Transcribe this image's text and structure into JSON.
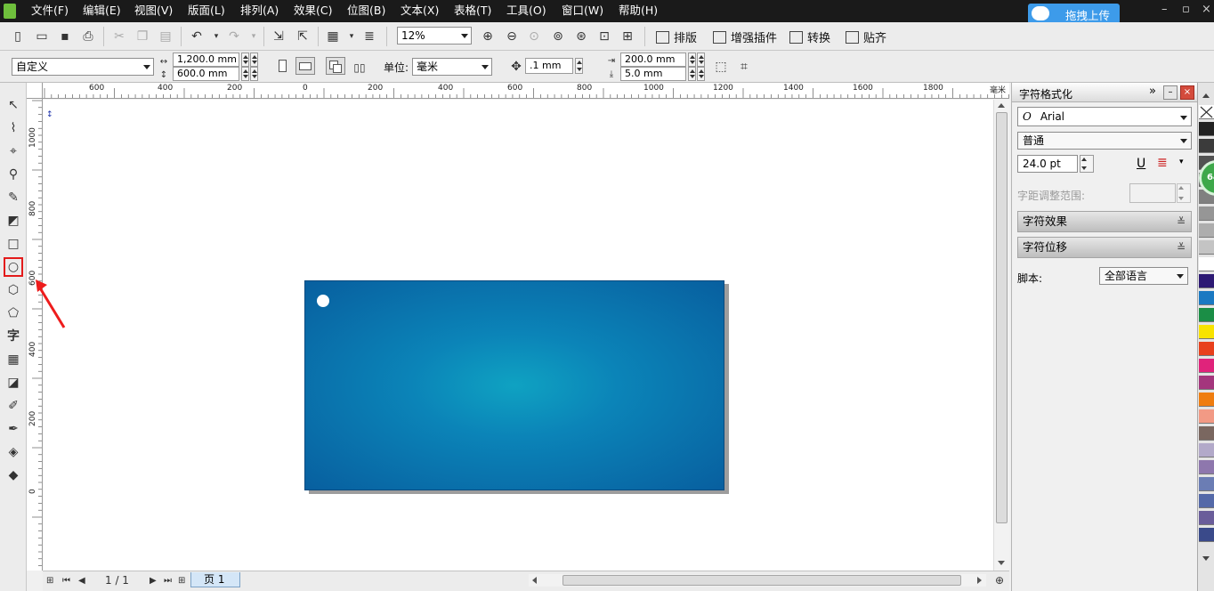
{
  "menu": {
    "items": [
      "文件(F)",
      "编辑(E)",
      "视图(V)",
      "版面(L)",
      "排列(A)",
      "效果(C)",
      "位图(B)",
      "文本(X)",
      "表格(T)",
      "工具(O)",
      "窗口(W)",
      "帮助(H)"
    ],
    "upload_button": "拖拽上传",
    "window_controls": [
      "–",
      "▫",
      "×"
    ]
  },
  "toolbar": {
    "zoom_level": "12%",
    "layout_buttons": [
      "排版",
      "增强插件",
      "转换",
      "贴齐"
    ]
  },
  "property_bar": {
    "paper_size": "自定义",
    "width": "1,200.0 mm",
    "height": "600.0 mm",
    "units_label": "单位:",
    "units_value": "毫米",
    "nudge": ".1 mm",
    "dup_x": "200.0 mm",
    "dup_y": "5.0 mm"
  },
  "rulers": {
    "horizontal_labels": [
      "600",
      "400",
      "200",
      "0",
      "200",
      "400",
      "600",
      "800",
      "1000",
      "1200",
      "1400",
      "1600",
      "1800",
      "毫米"
    ],
    "vertical_labels": [
      "1000",
      "800",
      "600",
      "400",
      "200",
      "0"
    ]
  },
  "canvas": {
    "corner_marker": "↕"
  },
  "navigation": {
    "page_counter": "1 / 1",
    "page_tab": "页 1"
  },
  "docker": {
    "title": "字符格式化",
    "font_name": "Arial",
    "font_style": "普通",
    "font_size": "24.0 pt",
    "kerning_label": "字距调整范围:",
    "section_effects": "字符效果",
    "section_shift": "字符位移",
    "script_label": "脚本:",
    "script_value": "全部语言"
  },
  "palette": {
    "colors": [
      "#ffffff",
      "#222222",
      "#3b3b3b",
      "#525252",
      "#6a6a6a",
      "#808080",
      "#969696",
      "#adadad",
      "#c4c4c4",
      "#ffffff",
      "#2d1a74",
      "#1b79c2",
      "#1b8e46",
      "#f8e300",
      "#e8401c",
      "#e0237b",
      "#a4367d",
      "#ef7d10",
      "#f29a85",
      "#7a6760",
      "#b2a9c9",
      "#8e77ad",
      "#6b7db4",
      "#5469a8",
      "#6a5d9a",
      "#3a4a8a"
    ],
    "badge_text": "64"
  }
}
